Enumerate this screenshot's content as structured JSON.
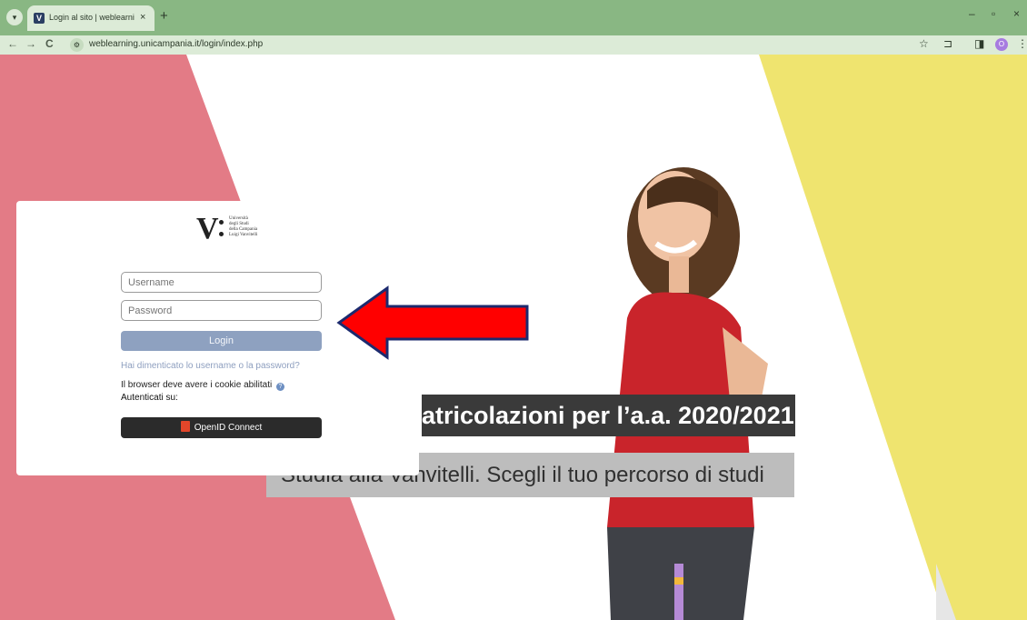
{
  "browser": {
    "tab_menu_icon": "chevron-down",
    "tab_title": "Login al sito | weblearning.unic...",
    "tab_close": "×",
    "new_tab": "+",
    "url": "weblearning.unicampania.it/login/index.php",
    "window": {
      "minimize": "–",
      "restore": "▫",
      "close": "×"
    },
    "nav": {
      "back": "←",
      "forward": "→",
      "reload": "C"
    },
    "toolbar_icons": {
      "star": "☆",
      "extensions": "⊐",
      "sidepanel": "◨",
      "menu": "⋮"
    },
    "profile_initial": "O"
  },
  "logo": {
    "letter": "V",
    "text": "Università\ndegli Studi\ndella Campania\nLuigi Vanvitelli"
  },
  "login": {
    "username_placeholder": "Username",
    "password_placeholder": "Password",
    "login_button": "Login",
    "forgot_link": "Hai dimenticato lo username o la password?",
    "cookies_text": "Il browser deve avere i cookie abilitati",
    "help_icon": "?",
    "auth_label": "Autenticati su:",
    "openid_button": "OpenID Connect"
  },
  "banner": {
    "title": "atricolazioni per l’a.a. 2020/2021",
    "subtitle": "Studia alla Vanvitelli. Scegli il tuo percorso di studi"
  },
  "colors": {
    "tab_bar": "#89b783",
    "toolbar": "#dcebd7",
    "pink": "#e37b86",
    "yellow": "#efe46f",
    "login_button": "#8ea1c0",
    "openid_button": "#2b2b2b",
    "arrow_fill": "#ff0000",
    "arrow_outline": "#1c2a6e",
    "shirt_red": "#c9242b"
  }
}
